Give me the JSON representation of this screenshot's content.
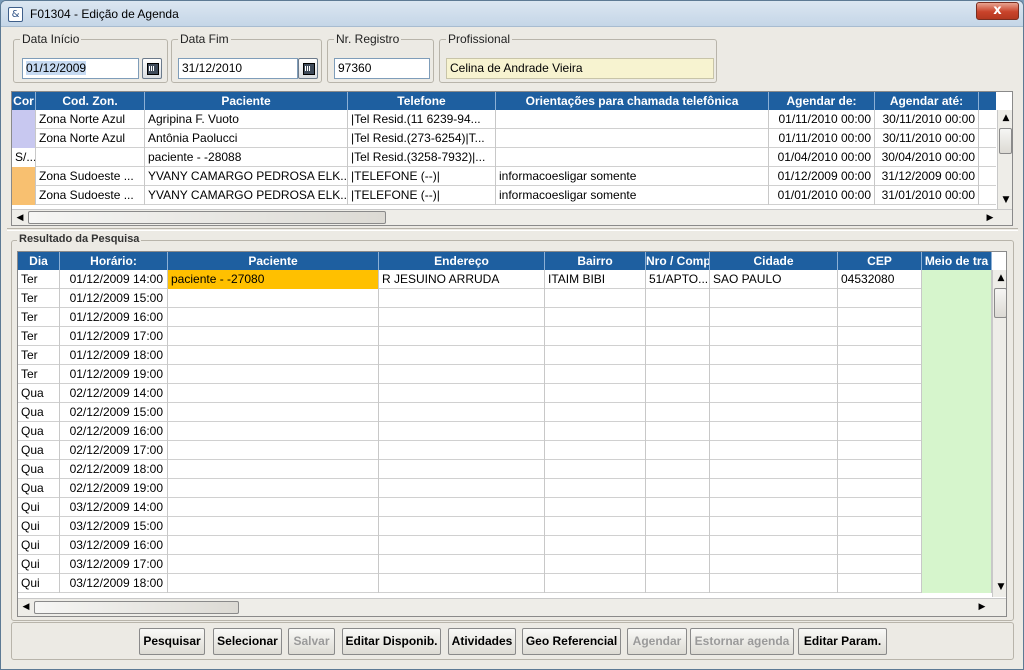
{
  "window": {
    "title": "F01304 - Edição de Agenda",
    "close_label": "x",
    "icon_glyph": "&"
  },
  "filters": {
    "data_inicio": {
      "label": "Data Início",
      "value": "01/12/2009"
    },
    "data_fim": {
      "label": "Data Fim",
      "value": "31/12/2010"
    },
    "nr_registro": {
      "label": "Nr. Registro",
      "value": "97360"
    },
    "profissional": {
      "label": "Profissional",
      "value": "Celina de Andrade Vieira"
    }
  },
  "top_table": {
    "headers": [
      "Cor",
      "Cod. Zon.",
      "Paciente",
      "Telefone",
      "Orientações para chamada telefônica",
      "Agendar de:",
      "Agendar até:"
    ],
    "rows": [
      {
        "cor": "",
        "color": "#c8c8f0",
        "zona": "Zona Norte Azul",
        "paciente": "Agripina F.  Vuoto",
        "telefone": "|Tel Resid.(11 6239-94...",
        "orient": "",
        "de": "01/11/2010 00:00",
        "ate": "30/11/2010 00:00"
      },
      {
        "cor": "",
        "color": "#c8c8f0",
        "zona": "Zona Norte Azul",
        "paciente": "Antônia Paolucci",
        "telefone": "|Tel Resid.(273-6254)|T...",
        "orient": "",
        "de": "01/11/2010 00:00",
        "ate": "30/11/2010 00:00"
      },
      {
        "cor": "S/...",
        "color": "#ffffff",
        "zona": "",
        "paciente": "paciente - -28088",
        "telefone": "|Tel Resid.(3258-7932)|...",
        "orient": "",
        "de": "01/04/2010 00:00",
        "ate": "30/04/2010 00:00"
      },
      {
        "cor": "",
        "color": "#f8c070",
        "zona": "Zona Sudoeste ...",
        "paciente": "YVANY CAMARGO PEDROSA ELK...",
        "telefone": "|TELEFONE (--)|",
        "orient": "informacoesligar somente",
        "de": "01/12/2009 00:00",
        "ate": "31/12/2009 00:00"
      },
      {
        "cor": "",
        "color": "#f8c070",
        "zona": "Zona Sudoeste ...",
        "paciente": "YVANY CAMARGO PEDROSA ELK...",
        "telefone": "|TELEFONE (--)|",
        "orient": "informacoesligar somente",
        "de": "01/01/2010 00:00",
        "ate": "31/01/2010 00:00"
      }
    ]
  },
  "results": {
    "section_label": "Resultado da Pesquisa",
    "headers": [
      "Dia",
      "Horário:",
      "Paciente",
      "Endereço",
      "Bairro",
      "Nro / Comp",
      "Cidade",
      "CEP",
      "Meio de tra"
    ],
    "rows": [
      {
        "dia": "Ter",
        "horario": "01/12/2009 14:00",
        "paciente": "paciente - -27080",
        "endereco": "R JESUINO ARRUDA",
        "bairro": "ITAIM BIBI",
        "nro": "51/APTO...",
        "cidade": "SAO PAULO",
        "cep": "04532080",
        "meio": ""
      },
      {
        "dia": "Ter",
        "horario": "01/12/2009 15:00",
        "paciente": "",
        "endereco": "",
        "bairro": "",
        "nro": "",
        "cidade": "",
        "cep": "",
        "meio": ""
      },
      {
        "dia": "Ter",
        "horario": "01/12/2009 16:00",
        "paciente": "",
        "endereco": "",
        "bairro": "",
        "nro": "",
        "cidade": "",
        "cep": "",
        "meio": ""
      },
      {
        "dia": "Ter",
        "horario": "01/12/2009 17:00",
        "paciente": "",
        "endereco": "",
        "bairro": "",
        "nro": "",
        "cidade": "",
        "cep": "",
        "meio": ""
      },
      {
        "dia": "Ter",
        "horario": "01/12/2009 18:00",
        "paciente": "",
        "endereco": "",
        "bairro": "",
        "nro": "",
        "cidade": "",
        "cep": "",
        "meio": ""
      },
      {
        "dia": "Ter",
        "horario": "01/12/2009 19:00",
        "paciente": "",
        "endereco": "",
        "bairro": "",
        "nro": "",
        "cidade": "",
        "cep": "",
        "meio": ""
      },
      {
        "dia": "Qua",
        "horario": "02/12/2009 14:00",
        "paciente": "",
        "endereco": "",
        "bairro": "",
        "nro": "",
        "cidade": "",
        "cep": "",
        "meio": ""
      },
      {
        "dia": "Qua",
        "horario": "02/12/2009 15:00",
        "paciente": "",
        "endereco": "",
        "bairro": "",
        "nro": "",
        "cidade": "",
        "cep": "",
        "meio": ""
      },
      {
        "dia": "Qua",
        "horario": "02/12/2009 16:00",
        "paciente": "",
        "endereco": "",
        "bairro": "",
        "nro": "",
        "cidade": "",
        "cep": "",
        "meio": ""
      },
      {
        "dia": "Qua",
        "horario": "02/12/2009 17:00",
        "paciente": "",
        "endereco": "",
        "bairro": "",
        "nro": "",
        "cidade": "",
        "cep": "",
        "meio": ""
      },
      {
        "dia": "Qua",
        "horario": "02/12/2009 18:00",
        "paciente": "",
        "endereco": "",
        "bairro": "",
        "nro": "",
        "cidade": "",
        "cep": "",
        "meio": ""
      },
      {
        "dia": "Qua",
        "horario": "02/12/2009 19:00",
        "paciente": "",
        "endereco": "",
        "bairro": "",
        "nro": "",
        "cidade": "",
        "cep": "",
        "meio": ""
      },
      {
        "dia": "Qui",
        "horario": "03/12/2009 14:00",
        "paciente": "",
        "endereco": "",
        "bairro": "",
        "nro": "",
        "cidade": "",
        "cep": "",
        "meio": ""
      },
      {
        "dia": "Qui",
        "horario": "03/12/2009 15:00",
        "paciente": "",
        "endereco": "",
        "bairro": "",
        "nro": "",
        "cidade": "",
        "cep": "",
        "meio": ""
      },
      {
        "dia": "Qui",
        "horario": "03/12/2009 16:00",
        "paciente": "",
        "endereco": "",
        "bairro": "",
        "nro": "",
        "cidade": "",
        "cep": "",
        "meio": ""
      },
      {
        "dia": "Qui",
        "horario": "03/12/2009 17:00",
        "paciente": "",
        "endereco": "",
        "bairro": "",
        "nro": "",
        "cidade": "",
        "cep": "",
        "meio": ""
      },
      {
        "dia": "Qui",
        "horario": "03/12/2009 18:00",
        "paciente": "",
        "endereco": "",
        "bairro": "",
        "nro": "",
        "cidade": "",
        "cep": "",
        "meio": ""
      }
    ]
  },
  "buttons": [
    {
      "label": "Pesquisar",
      "enabled": true
    },
    {
      "label": "Selecionar",
      "enabled": true
    },
    {
      "label": "Salvar",
      "enabled": false
    },
    {
      "label": "Editar Disponib.",
      "enabled": true
    },
    {
      "label": "Atividades",
      "enabled": true
    },
    {
      "label": "Geo Referencial",
      "enabled": true
    },
    {
      "label": "Agendar",
      "enabled": false
    },
    {
      "label": "Estornar agenda",
      "enabled": false
    },
    {
      "label": "Editar Param.",
      "enabled": true
    }
  ],
  "colors": {
    "header_bg": "#1e5fa0",
    "highlight_cell": "#ffc000",
    "meio_column": "#d6f5cc",
    "profissional_bg": "#f7f3d0",
    "selection_text_bg": "#c6daf2"
  }
}
